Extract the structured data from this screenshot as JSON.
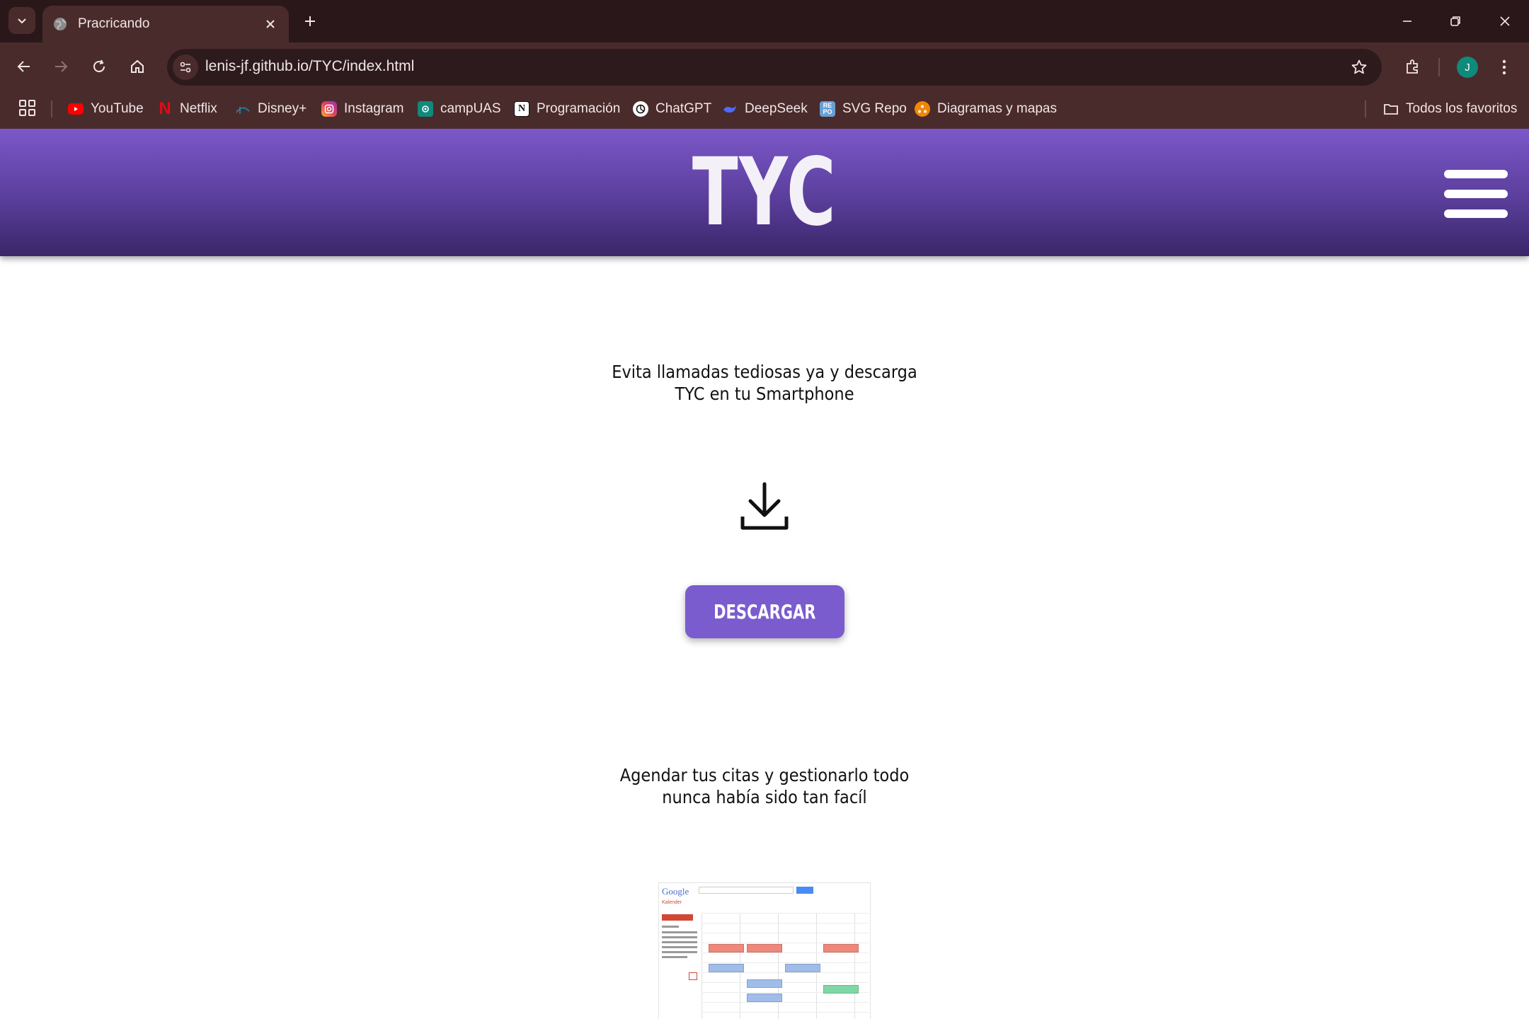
{
  "browser": {
    "tab_title": "Pracricando",
    "url": "lenis-jf.github.io/TYC/index.html",
    "avatar_letter": "J",
    "bookmarks": [
      {
        "label": "YouTube",
        "icon": "youtube-icon",
        "color": "#ff0000"
      },
      {
        "label": "Netflix",
        "icon": "netflix-icon",
        "color": "#e50914"
      },
      {
        "label": "Disney+",
        "icon": "disney-icon",
        "color": "#1a5c7a"
      },
      {
        "label": "Instagram",
        "icon": "instagram-icon",
        "color": "#d6249f"
      },
      {
        "label": "campUAS",
        "icon": "campuas-icon",
        "color": "#0f8a7b"
      },
      {
        "label": "Programación",
        "icon": "notion-icon",
        "color": "#ffffff"
      },
      {
        "label": "ChatGPT",
        "icon": "chatgpt-icon",
        "color": "#ffffff"
      },
      {
        "label": "DeepSeek",
        "icon": "deepseek-icon",
        "color": "#4d6bfe"
      },
      {
        "label": "SVG Repo",
        "icon": "svgrepo-icon",
        "color": "#6a9fd4"
      },
      {
        "label": "Diagramas y mapas",
        "icon": "diagrams-icon",
        "color": "#f08705"
      }
    ],
    "all_bookmarks_label": "Todos los favoritos"
  },
  "site": {
    "logo": "TYC",
    "hero_line1": "Evita llamadas tediosas ya y descarga",
    "hero_line2": "TYC en tu Smartphone",
    "download_button": "DESCARGAR",
    "sub_line1": "Agendar tus citas y gestionarlo todo",
    "sub_line2": "nunca había sido tan facíl",
    "header_color": "#5a3e9b",
    "button_color": "#7a5ccf"
  },
  "calendar_image": {
    "logo": "Google",
    "title": "Kalender"
  }
}
